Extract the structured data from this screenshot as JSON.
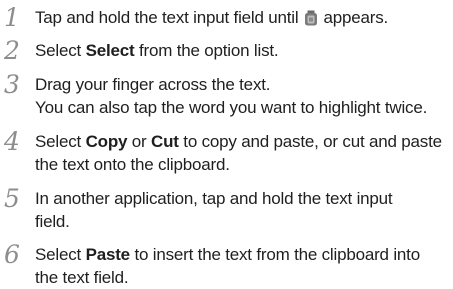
{
  "steps": [
    {
      "number": "1",
      "before_icon": "Tap and hold the text input field until ",
      "icon": "text-selection-handle-icon",
      "after_icon": " appears."
    },
    {
      "number": "2",
      "pre": "Select ",
      "bold": "Select",
      "post": " from the option list."
    },
    {
      "number": "3",
      "line1": "Drag your finger across the text.",
      "line2": "You can also tap the word you want to highlight twice."
    },
    {
      "number": "4",
      "pre": "Select ",
      "bold1": "Copy",
      "mid": " or ",
      "bold2": "Cut",
      "post": " to copy and paste, or cut and paste",
      "line2": "the text onto the clipboard."
    },
    {
      "number": "5",
      "line1": "In another application, tap and hold the text input",
      "line2": "field."
    },
    {
      "number": "6",
      "pre": "Select ",
      "bold": "Paste",
      "post": " to insert the text from the clipboard into",
      "line2": "the text field."
    }
  ],
  "colors": {
    "step_number": "#8d8d8d",
    "body_text": "#1f1f1f",
    "background": "#ffffff"
  }
}
